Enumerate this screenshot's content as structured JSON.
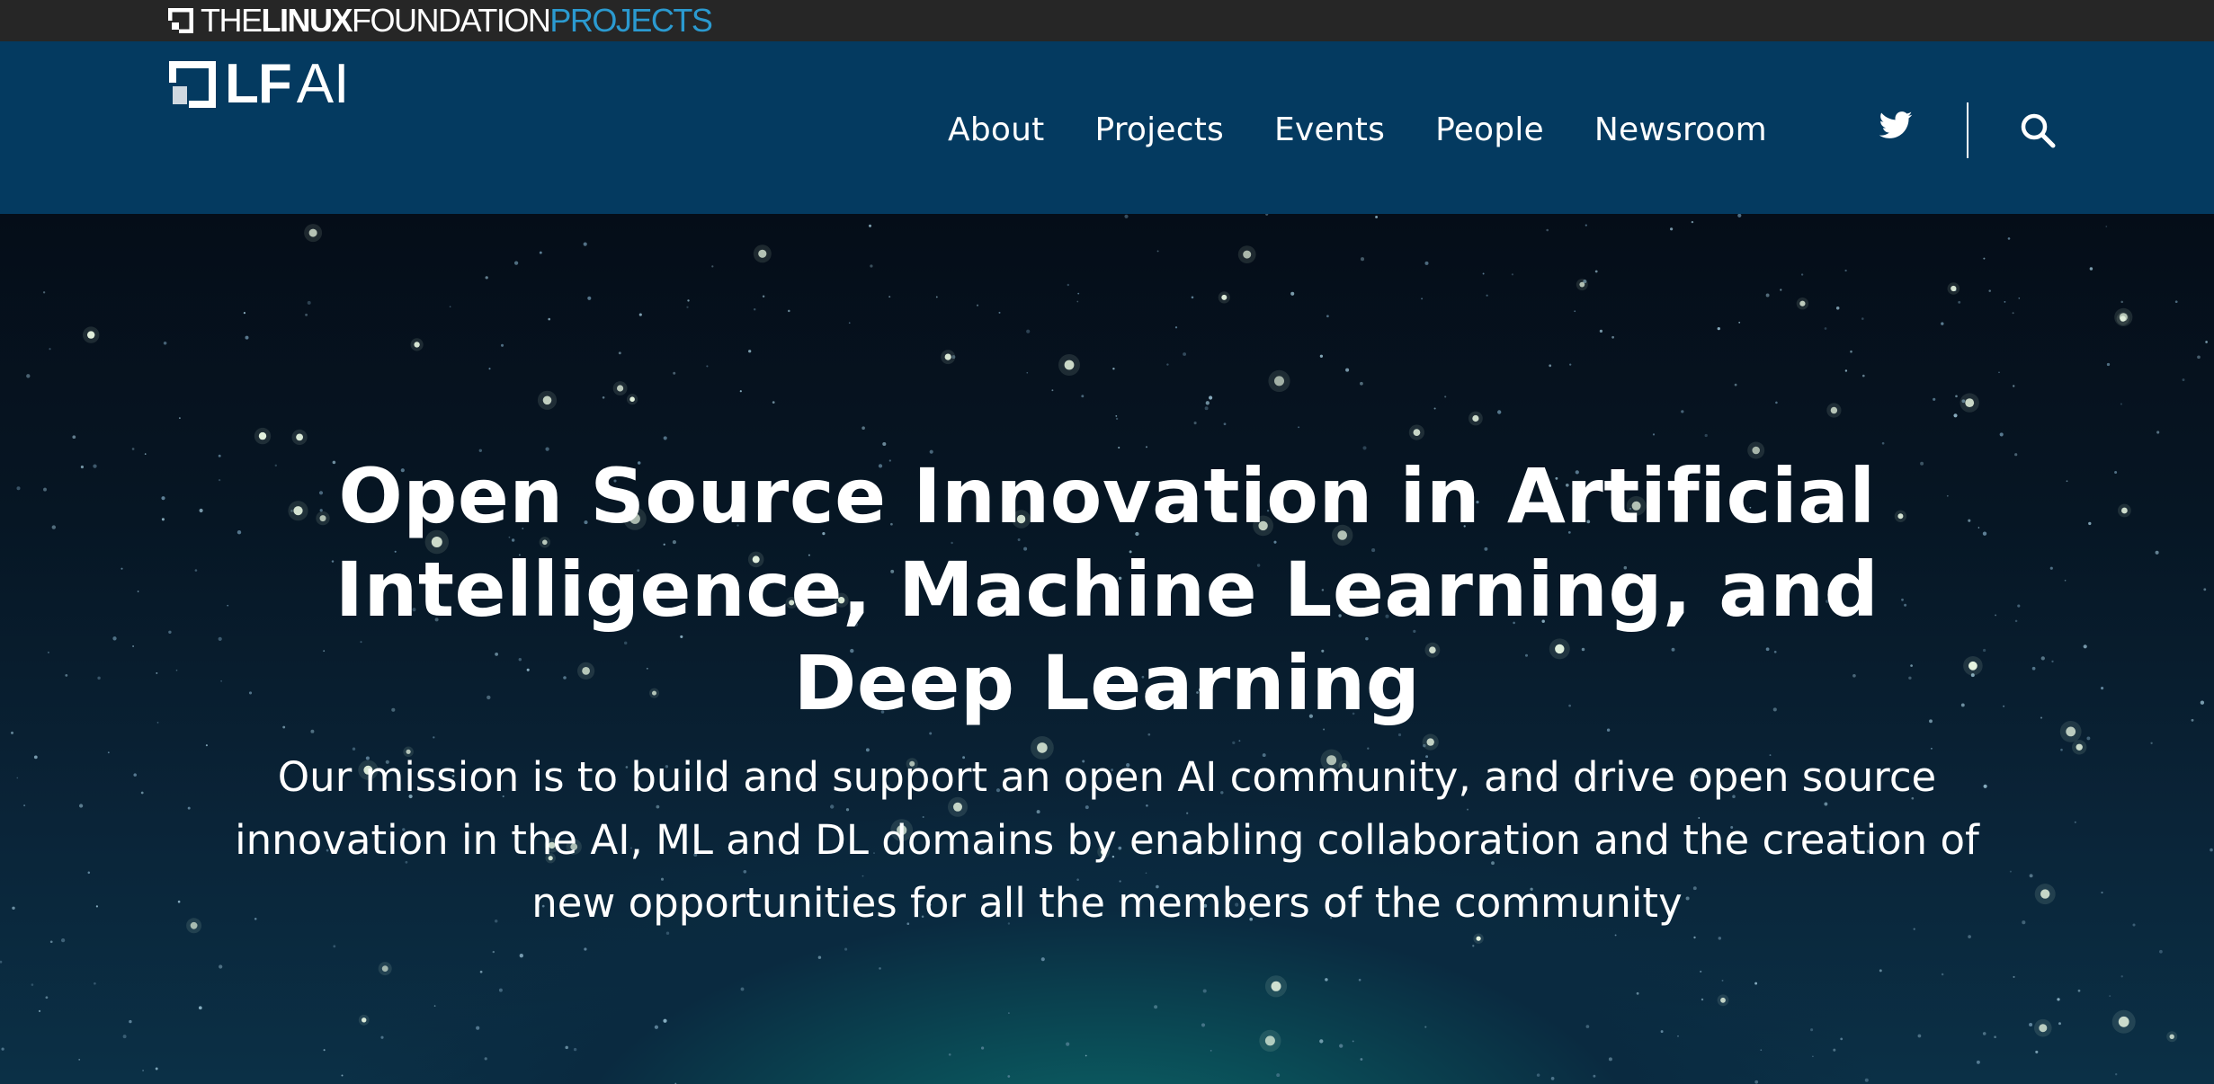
{
  "topbar": {
    "brand": {
      "the": "THE",
      "linux": "LINUX",
      "foundation": "FOUNDATION",
      "projects": "PROJECTS"
    }
  },
  "header": {
    "logo": {
      "lf": "LF",
      "ai": "AI"
    },
    "nav": [
      {
        "label": "About"
      },
      {
        "label": "Projects"
      },
      {
        "label": "Events"
      },
      {
        "label": "People"
      },
      {
        "label": "Newsroom"
      }
    ],
    "icons": {
      "social": "twitter-icon",
      "search": "search-icon"
    }
  },
  "hero": {
    "title": "Open Source Innovation in Artificial Intelligence, Machine Learning, and Deep Learning",
    "subtitle": "Our mission is to build and support an open AI community, and drive open source innovation in the AI, ML and DL domains by enabling collaboration and the creation of new opportunities for all the members of the community"
  },
  "colors": {
    "topbar_bg": "#262626",
    "header_bg": "#043a60",
    "projects_accent": "#2b9ad0",
    "hero_glow": "#0d6a6a"
  }
}
